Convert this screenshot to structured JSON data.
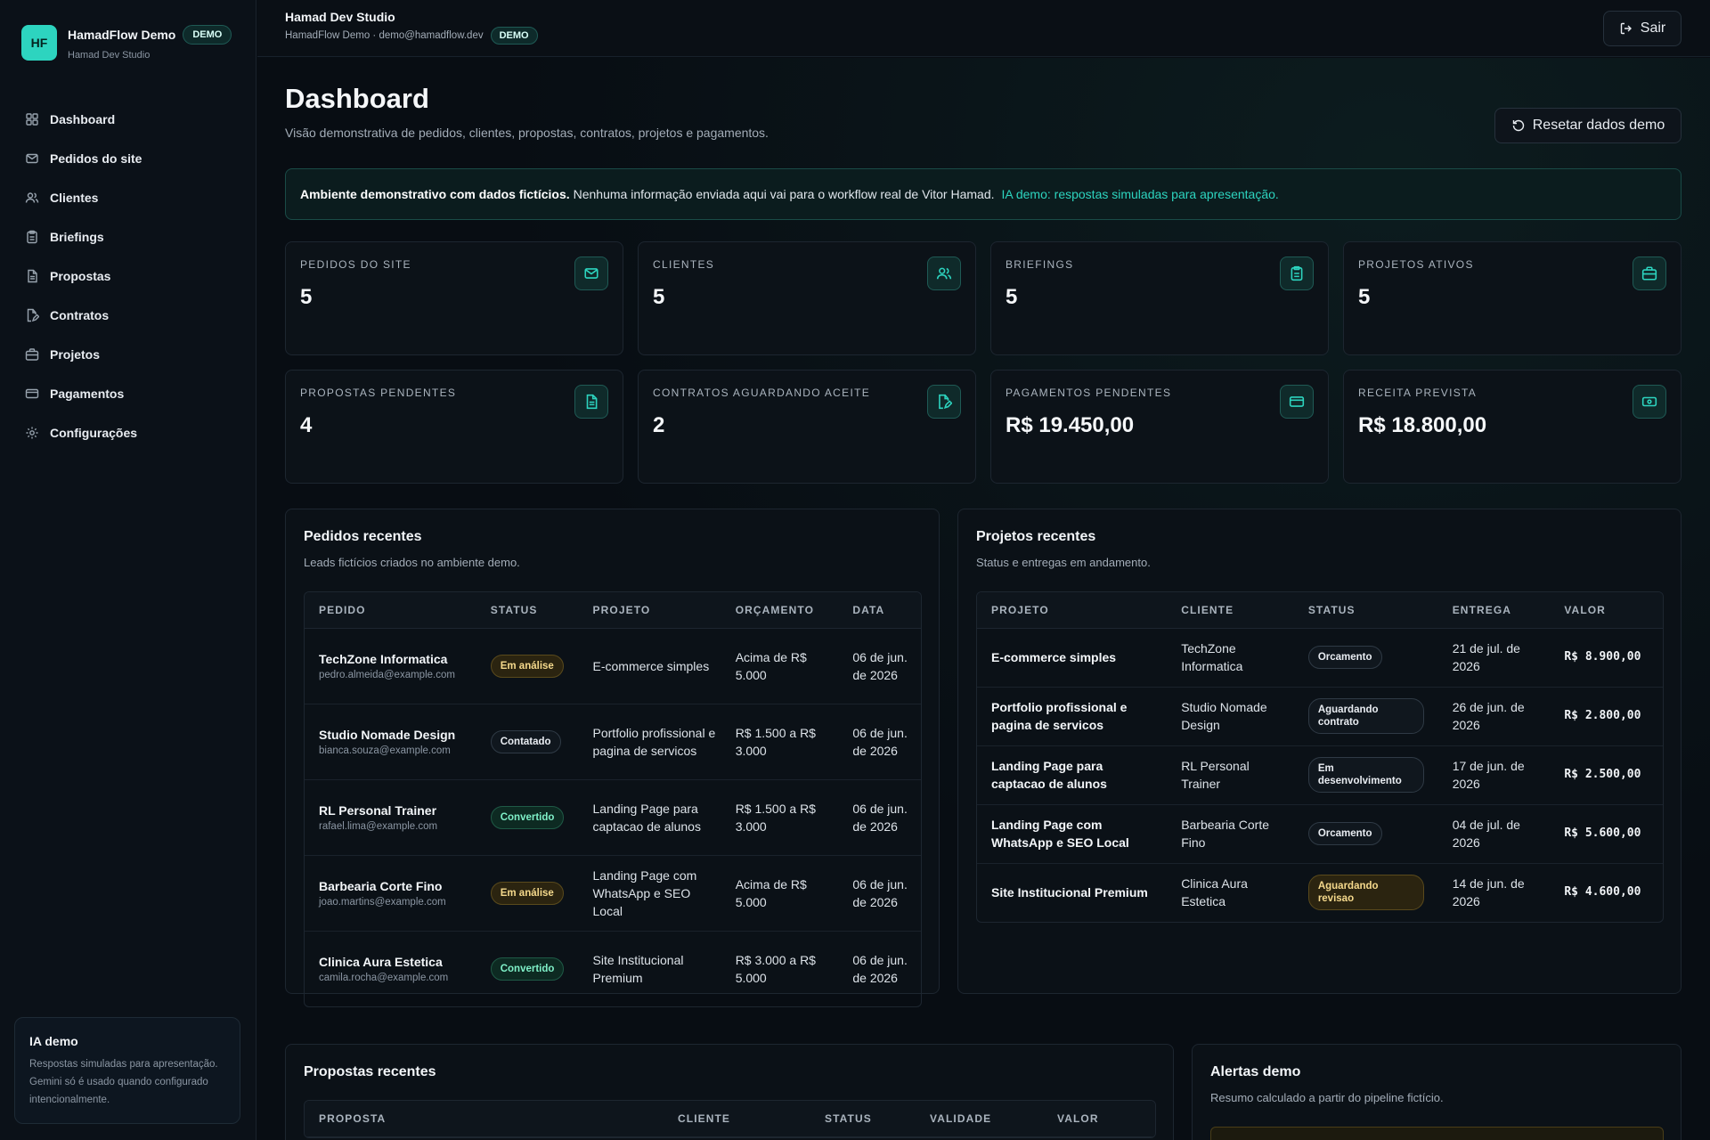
{
  "brand": {
    "initials": "HF",
    "name": "HamadFlow Demo",
    "badge": "DEMO",
    "studio": "Hamad Dev Studio"
  },
  "nav": {
    "items": [
      {
        "label": "Dashboard",
        "icon": "grid-icon"
      },
      {
        "label": "Pedidos do site",
        "icon": "mail-icon"
      },
      {
        "label": "Clientes",
        "icon": "users-icon"
      },
      {
        "label": "Briefings",
        "icon": "clipboard-icon"
      },
      {
        "label": "Propostas",
        "icon": "file-icon"
      },
      {
        "label": "Contratos",
        "icon": "file-signature-icon"
      },
      {
        "label": "Projetos",
        "icon": "briefcase-icon"
      },
      {
        "label": "Pagamentos",
        "icon": "credit-card-icon"
      },
      {
        "label": "Configurações",
        "icon": "gear-icon"
      }
    ]
  },
  "ia_card": {
    "title": "IA demo",
    "text": "Respostas simuladas para apresentação. Gemini só é usado quando configurado intencionalmente."
  },
  "topbar": {
    "title": "Hamad Dev Studio",
    "subtitle": "HamadFlow Demo · demo@hamadflow.dev",
    "badge": "DEMO",
    "logout": "Sair"
  },
  "header": {
    "title": "Dashboard",
    "subtitle": "Visão demonstrativa de pedidos, clientes, propostas, contratos, projetos e pagamentos.",
    "reset": "Resetar dados demo"
  },
  "banner": {
    "strong": "Ambiente demonstrativo com dados fictícios.",
    "text": "Nenhuma informação enviada aqui vai para o workflow real de Vitor Hamad.",
    "link": "IA demo: respostas simuladas para apresentação."
  },
  "stats": [
    {
      "label": "PEDIDOS DO SITE",
      "value": "5",
      "icon": "mail-icon"
    },
    {
      "label": "CLIENTES",
      "value": "5",
      "icon": "users-icon"
    },
    {
      "label": "BRIEFINGS",
      "value": "5",
      "icon": "clipboard-icon"
    },
    {
      "label": "PROJETOS ATIVOS",
      "value": "5",
      "icon": "briefcase-icon"
    },
    {
      "label": "PROPOSTAS PENDENTES",
      "value": "4",
      "icon": "file-icon"
    },
    {
      "label": "CONTRATOS AGUARDANDO ACEITE",
      "value": "2",
      "icon": "file-signature-icon"
    },
    {
      "label": "PAGAMENTOS PENDENTES",
      "value": "R$ 19.450,00",
      "icon": "credit-card-icon"
    },
    {
      "label": "RECEITA PREVISTA",
      "value": "R$ 18.800,00",
      "icon": "banknote-icon"
    }
  ],
  "orders": {
    "title": "Pedidos recentes",
    "subtitle": "Leads fictícios criados no ambiente demo.",
    "columns": [
      "PEDIDO",
      "STATUS",
      "PROJETO",
      "ORÇAMENTO",
      "DATA"
    ],
    "rows": [
      {
        "name": "TechZone Informatica",
        "email": "pedro.almeida@example.com",
        "status": "Em análise",
        "kind": "analysis",
        "project": "E-commerce simples",
        "budget": "Acima de R$ 5.000",
        "date": "06 de jun. de 2026"
      },
      {
        "name": "Studio Nomade Design",
        "email": "bianca.souza@example.com",
        "status": "Contatado",
        "kind": "contact",
        "project": "Portfolio profissional e pagina de servicos",
        "budget": "R$ 1.500 a R$ 3.000",
        "date": "06 de jun. de 2026"
      },
      {
        "name": "RL Personal Trainer",
        "email": "rafael.lima@example.com",
        "status": "Convertido",
        "kind": "converted",
        "project": "Landing Page para captacao de alunos",
        "budget": "R$ 1.500 a R$ 3.000",
        "date": "06 de jun. de 2026"
      },
      {
        "name": "Barbearia Corte Fino",
        "email": "joao.martins@example.com",
        "status": "Em análise",
        "kind": "analysis",
        "project": "Landing Page com WhatsApp e SEO Local",
        "budget": "Acima de R$ 5.000",
        "date": "06 de jun. de 2026"
      },
      {
        "name": "Clinica Aura Estetica",
        "email": "camila.rocha@example.com",
        "status": "Convertido",
        "kind": "converted",
        "project": "Site Institucional Premium",
        "budget": "R$ 3.000 a R$ 5.000",
        "date": "06 de jun. de 2026"
      }
    ]
  },
  "projects": {
    "title": "Projetos recentes",
    "subtitle": "Status e entregas em andamento.",
    "columns": [
      "PROJETO",
      "CLIENTE",
      "STATUS",
      "ENTREGA",
      "VALOR"
    ],
    "rows": [
      {
        "project": "E-commerce simples",
        "client": "TechZone Informatica",
        "status": "Orcamento",
        "kind": "contact",
        "due": "21 de jul. de 2026",
        "value": "R$ 8.900,00"
      },
      {
        "project": "Portfolio profissional e pagina de servicos",
        "client": "Studio Nomade Design",
        "status": "Aguardando contrato",
        "kind": "contact",
        "due": "26 de jun. de 2026",
        "value": "R$ 2.800,00"
      },
      {
        "project": "Landing Page para captacao de alunos",
        "client": "RL Personal Trainer",
        "status": "Em desenvolvimento",
        "kind": "contact",
        "due": "17 de jun. de 2026",
        "value": "R$ 2.500,00"
      },
      {
        "project": "Landing Page com WhatsApp e SEO Local",
        "client": "Barbearia Corte Fino",
        "status": "Orcamento",
        "kind": "contact",
        "due": "04 de jul. de 2026",
        "value": "R$ 5.600,00"
      },
      {
        "project": "Site Institucional Premium",
        "client": "Clinica Aura Estetica",
        "status": "Aguardando revisao",
        "kind": "review",
        "due": "14 de jun. de 2026",
        "value": "R$ 4.600,00"
      }
    ]
  },
  "proposals": {
    "title": "Propostas recentes",
    "columns": [
      "PROPOSTA",
      "CLIENTE",
      "STATUS",
      "VALIDADE",
      "VALOR"
    ]
  },
  "alerts": {
    "title": "Alertas demo",
    "subtitle": "Resumo calculado a partir do pipeline fictício."
  },
  "colors": {
    "accent": "#2dd4bf",
    "background": "#080d13",
    "panel": "#0b1117",
    "border": "#1d2630"
  }
}
